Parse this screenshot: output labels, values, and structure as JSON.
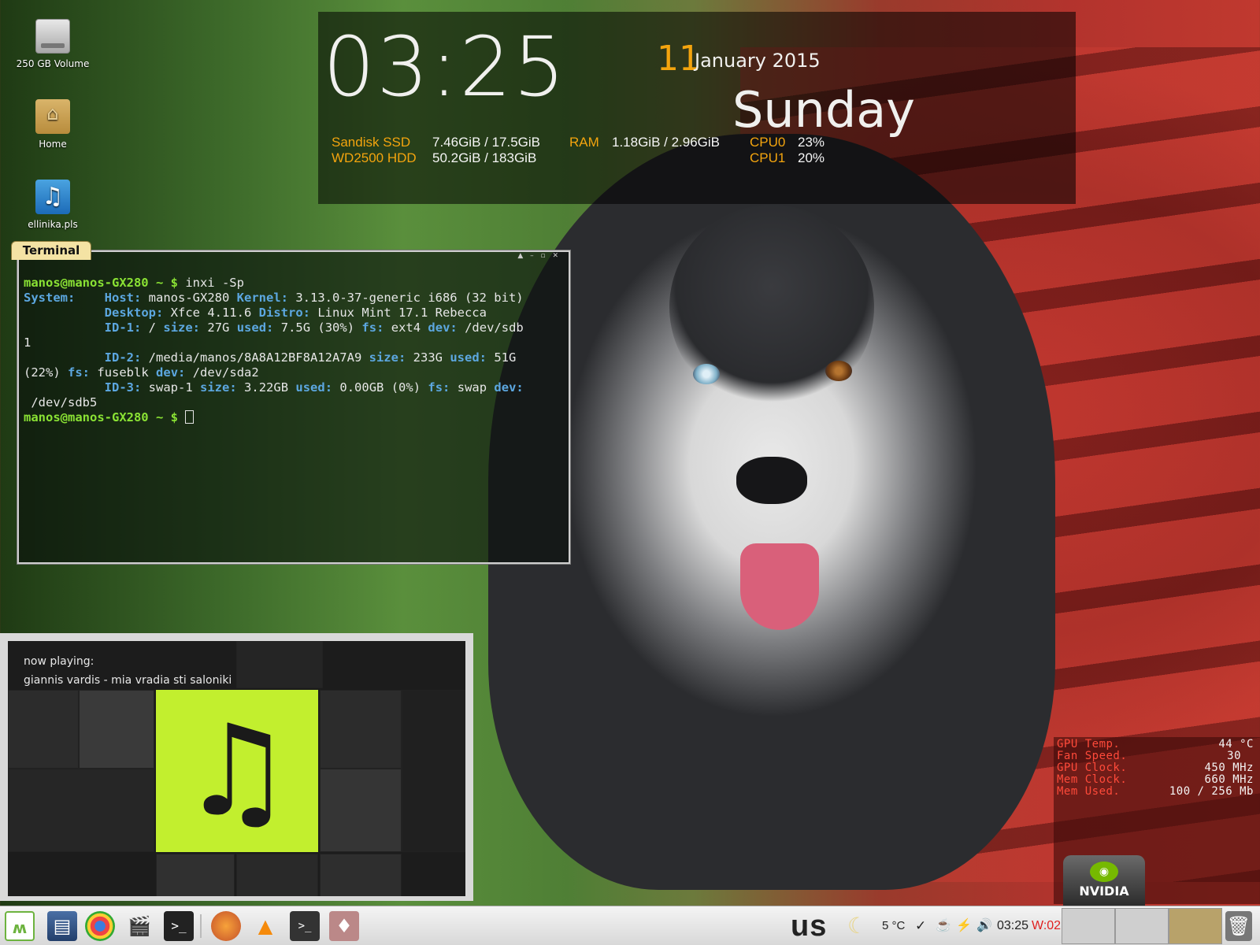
{
  "desktop_icons": [
    {
      "name": "drive-icon",
      "label": "250 GB Volume"
    },
    {
      "name": "home-folder-icon",
      "label": "Home"
    },
    {
      "name": "playlist-file-icon",
      "label": "ellinika.pls"
    }
  ],
  "conky": {
    "time": "03:25",
    "day": "11",
    "month_year": "January 2015",
    "weekday": "Sunday",
    "sandisk_label": "Sandisk SSD",
    "sandisk_value": "7.46GiB / 17.5GiB",
    "wd_label": "WD2500 HDD",
    "wd_value": "50.2GiB / 183GiB",
    "ram_label": "RAM",
    "ram_value": "1.18GiB / 2.96GiB",
    "cpu0_label": "CPU0",
    "cpu0_value": "23%",
    "cpu1_label": "CPU1",
    "cpu1_value": "20%"
  },
  "terminal": {
    "tab_title": "Terminal",
    "window_controls": "▲ – ▫ ✕",
    "prompt": "manos@manos-GX280 ~ $",
    "command": "inxi -Sp",
    "system_label": "System:",
    "host_label": "Host:",
    "host_value": "manos-GX280",
    "kernel_label": "Kernel:",
    "kernel_value": "3.13.0-37-generic i686 (32 bit)",
    "desktop_label": "Desktop:",
    "desktop_value": "Xfce 4.11.6",
    "distro_label": "Distro:",
    "distro_value": "Linux Mint 17.1 Rebecca",
    "id1_label": "ID-1:",
    "id1_path": "/",
    "id1_size_label": "size:",
    "id1_size": "27G",
    "id1_used_label": "used:",
    "id1_used": "7.5G (30%)",
    "id1_fs_label": "fs:",
    "id1_fs": "ext4",
    "id1_dev_label": "dev:",
    "id1_dev": "/dev/sdb",
    "id1_dev_wrap": "1",
    "id2_label": "ID-2:",
    "id2_path": "/media/manos/8A8A12BF8A12A7A9",
    "id2_size_label": "size:",
    "id2_size": "233G",
    "id2_used_label": "used:",
    "id2_used": "51G",
    "id2_used_wrap": "(22%)",
    "id2_fs_label": "fs:",
    "id2_fs": "fuseblk",
    "id2_dev_label": "dev:",
    "id2_dev": "/dev/sda2",
    "id3_label": "ID-3:",
    "id3_path": "swap-1",
    "id3_size_label": "size:",
    "id3_size": "3.22GB",
    "id3_used_label": "used:",
    "id3_used": "0.00GB (0%)",
    "id3_fs_label": "fs:",
    "id3_fs": "swap",
    "id3_dev_label": "dev:",
    "id3_dev": "/dev/sdb5"
  },
  "now_playing": {
    "label": "now playing:",
    "track": "giannis vardis - mia vradia sti saloniki",
    "art_icon": "music-note-icon",
    "art_color": "#c2ef2e"
  },
  "gpu": {
    "temp_label": "GPU Temp.",
    "temp_value": "44 °C",
    "fan_label": "Fan Speed.",
    "fan_value": "30",
    "clock_label": "GPU Clock.",
    "clock_value": "450 MHz",
    "mem_clock_label": "Mem Clock.",
    "mem_clock_value": "660 MHz",
    "mem_used_label": "Mem Used.",
    "mem_used_value": "100 / 256 Mb",
    "brand": "NVIDIA"
  },
  "taskbar": {
    "launchers": [
      "linux-mint-menu-icon",
      "file-manager-icon",
      "chrome-icon",
      "video-editor-icon",
      "terminal-icon"
    ],
    "tasks": [
      "firefox-icon",
      "vlc-icon",
      "terminal-task-icon",
      "suit-icon"
    ],
    "keyboard_layout": "us",
    "weather": "5 °C",
    "clock": "03:25",
    "week": "W:02"
  },
  "colors": {
    "accent_orange": "#f3a40e",
    "gpu_red": "#ff4a3a",
    "prompt_green": "#8ae234",
    "label_blue": "#5ca7e0"
  }
}
